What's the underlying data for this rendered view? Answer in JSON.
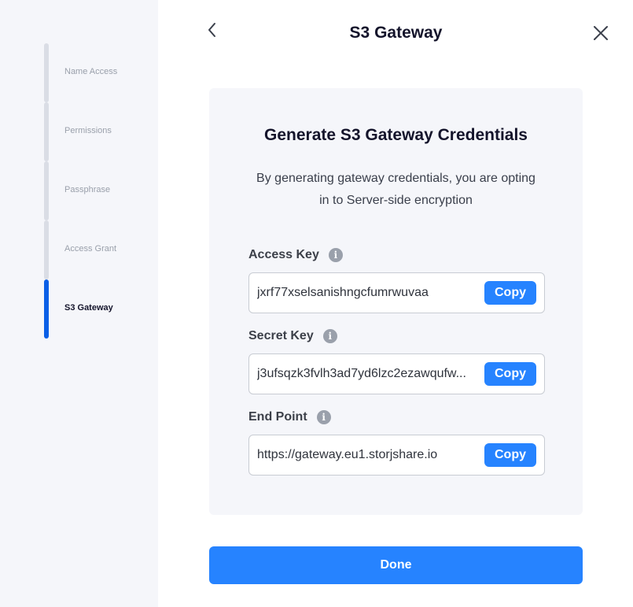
{
  "sidebar": {
    "steps": [
      {
        "label": "Name Access"
      },
      {
        "label": "Permissions"
      },
      {
        "label": "Passphrase"
      },
      {
        "label": "Access Grant"
      },
      {
        "label": "S3 Gateway"
      }
    ],
    "active_step": "S3 Gateway"
  },
  "header": {
    "title": "S3 Gateway"
  },
  "card": {
    "title": "Generate S3 Gateway Credentials",
    "description": "By generating gateway credentials, you are opting in to Server-side encryption",
    "fields": [
      {
        "label": "Access Key",
        "value": "jxrf77xselsanishngcfumrwuvaa",
        "copy_label": "Copy"
      },
      {
        "label": "Secret Key",
        "value": "j3ufsqzk3fvlh3ad7yd6lzc2ezawqufw...",
        "copy_label": "Copy"
      },
      {
        "label": "End Point",
        "value": "https://gateway.eu1.storjshare.io",
        "copy_label": "Copy"
      }
    ]
  },
  "done_label": "Done",
  "colors": {
    "accent": "#2683ff",
    "active_step_bar": "#0a5fe6",
    "sidebar_bg": "#f5f6fa",
    "card_bg": "#f5f6fa"
  },
  "icons": {
    "back": "chevron-left-icon",
    "close": "close-icon",
    "info": "info-icon"
  }
}
